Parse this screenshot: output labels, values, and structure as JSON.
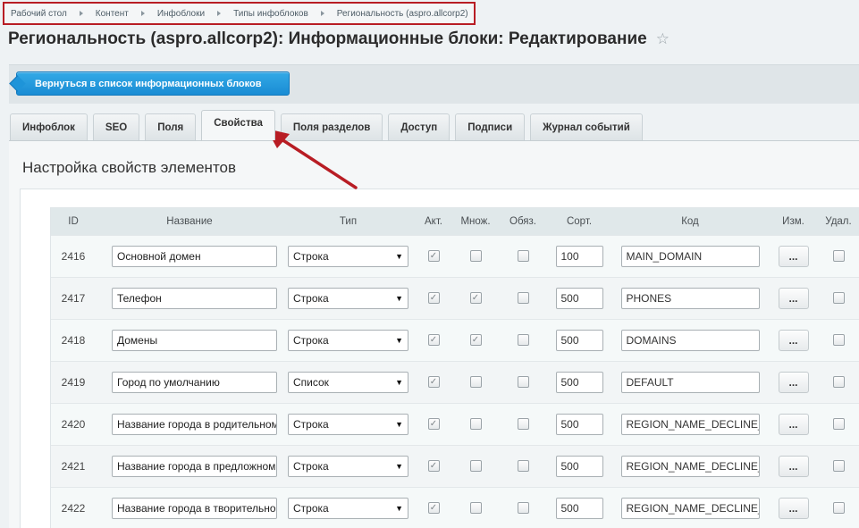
{
  "breadcrumb": [
    "Рабочий стол",
    "Контент",
    "Инфоблоки",
    "Типы инфоблоков",
    "Региональность (aspro.allcorp2)"
  ],
  "page_title": "Региональность (aspro.allcorp2): Информационные блоки: Редактирование",
  "back_button": "Вернуться в список информационных блоков",
  "tabs": [
    {
      "label": "Инфоблок",
      "active": false
    },
    {
      "label": "SEO",
      "active": false
    },
    {
      "label": "Поля",
      "active": false
    },
    {
      "label": "Свойства",
      "active": true
    },
    {
      "label": "Поля разделов",
      "active": false
    },
    {
      "label": "Доступ",
      "active": false
    },
    {
      "label": "Подписи",
      "active": false
    },
    {
      "label": "Журнал событий",
      "active": false
    }
  ],
  "section_title": "Настройка свойств элементов",
  "columns": [
    "ID",
    "Название",
    "Тип",
    "Акт.",
    "Множ.",
    "Обяз.",
    "Сорт.",
    "Код",
    "Изм.",
    "Удал."
  ],
  "rows": [
    {
      "id": "2416",
      "name": "Основной домен",
      "type": "Строка",
      "active": true,
      "multiple": false,
      "required": false,
      "sort": "100",
      "code": "MAIN_DOMAIN",
      "edit": "..."
    },
    {
      "id": "2417",
      "name": "Телефон",
      "type": "Строка",
      "active": true,
      "multiple": true,
      "required": false,
      "sort": "500",
      "code": "PHONES",
      "edit": "..."
    },
    {
      "id": "2418",
      "name": "Домены",
      "type": "Строка",
      "active": true,
      "multiple": true,
      "required": false,
      "sort": "500",
      "code": "DOMAINS",
      "edit": "..."
    },
    {
      "id": "2419",
      "name": "Город по умолчанию",
      "type": "Список",
      "active": true,
      "multiple": false,
      "required": false,
      "sort": "500",
      "code": "DEFAULT",
      "edit": "..."
    },
    {
      "id": "2420",
      "name": "Название города в родительном",
      "type": "Строка",
      "active": true,
      "multiple": false,
      "required": false,
      "sort": "500",
      "code": "REGION_NAME_DECLINE_",
      "edit": "..."
    },
    {
      "id": "2421",
      "name": "Название города в предложном",
      "type": "Строка",
      "active": true,
      "multiple": false,
      "required": false,
      "sort": "500",
      "code": "REGION_NAME_DECLINE_",
      "edit": "..."
    },
    {
      "id": "2422",
      "name": "Название города в творительном",
      "type": "Строка",
      "active": true,
      "multiple": false,
      "required": false,
      "sort": "500",
      "code": "REGION_NAME_DECLINE_",
      "edit": "..."
    }
  ],
  "colors": {
    "accent": "#1a8cd4",
    "annotation": "#b81d24"
  }
}
